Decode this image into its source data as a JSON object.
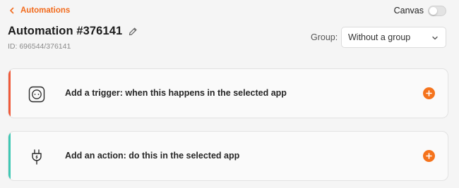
{
  "header": {
    "back_label": "Automations",
    "canvas_label": "Canvas",
    "canvas_enabled": false
  },
  "automation": {
    "title": "Automation #376141",
    "id_text": "ID: 696544/376141"
  },
  "group": {
    "label": "Group:",
    "selected": "Without a group"
  },
  "steps": [
    {
      "kind": "trigger",
      "label": "Add a trigger: when this happens in the selected app",
      "icon": "trigger-icon",
      "accent_color": "#f05a3a"
    },
    {
      "kind": "action",
      "label": "Add an action: do this in the selected app",
      "icon": "plug-icon",
      "accent_color": "#3ec8b4"
    }
  ],
  "colors": {
    "brand": "#f26b1d",
    "add_button": "#f5731c"
  }
}
